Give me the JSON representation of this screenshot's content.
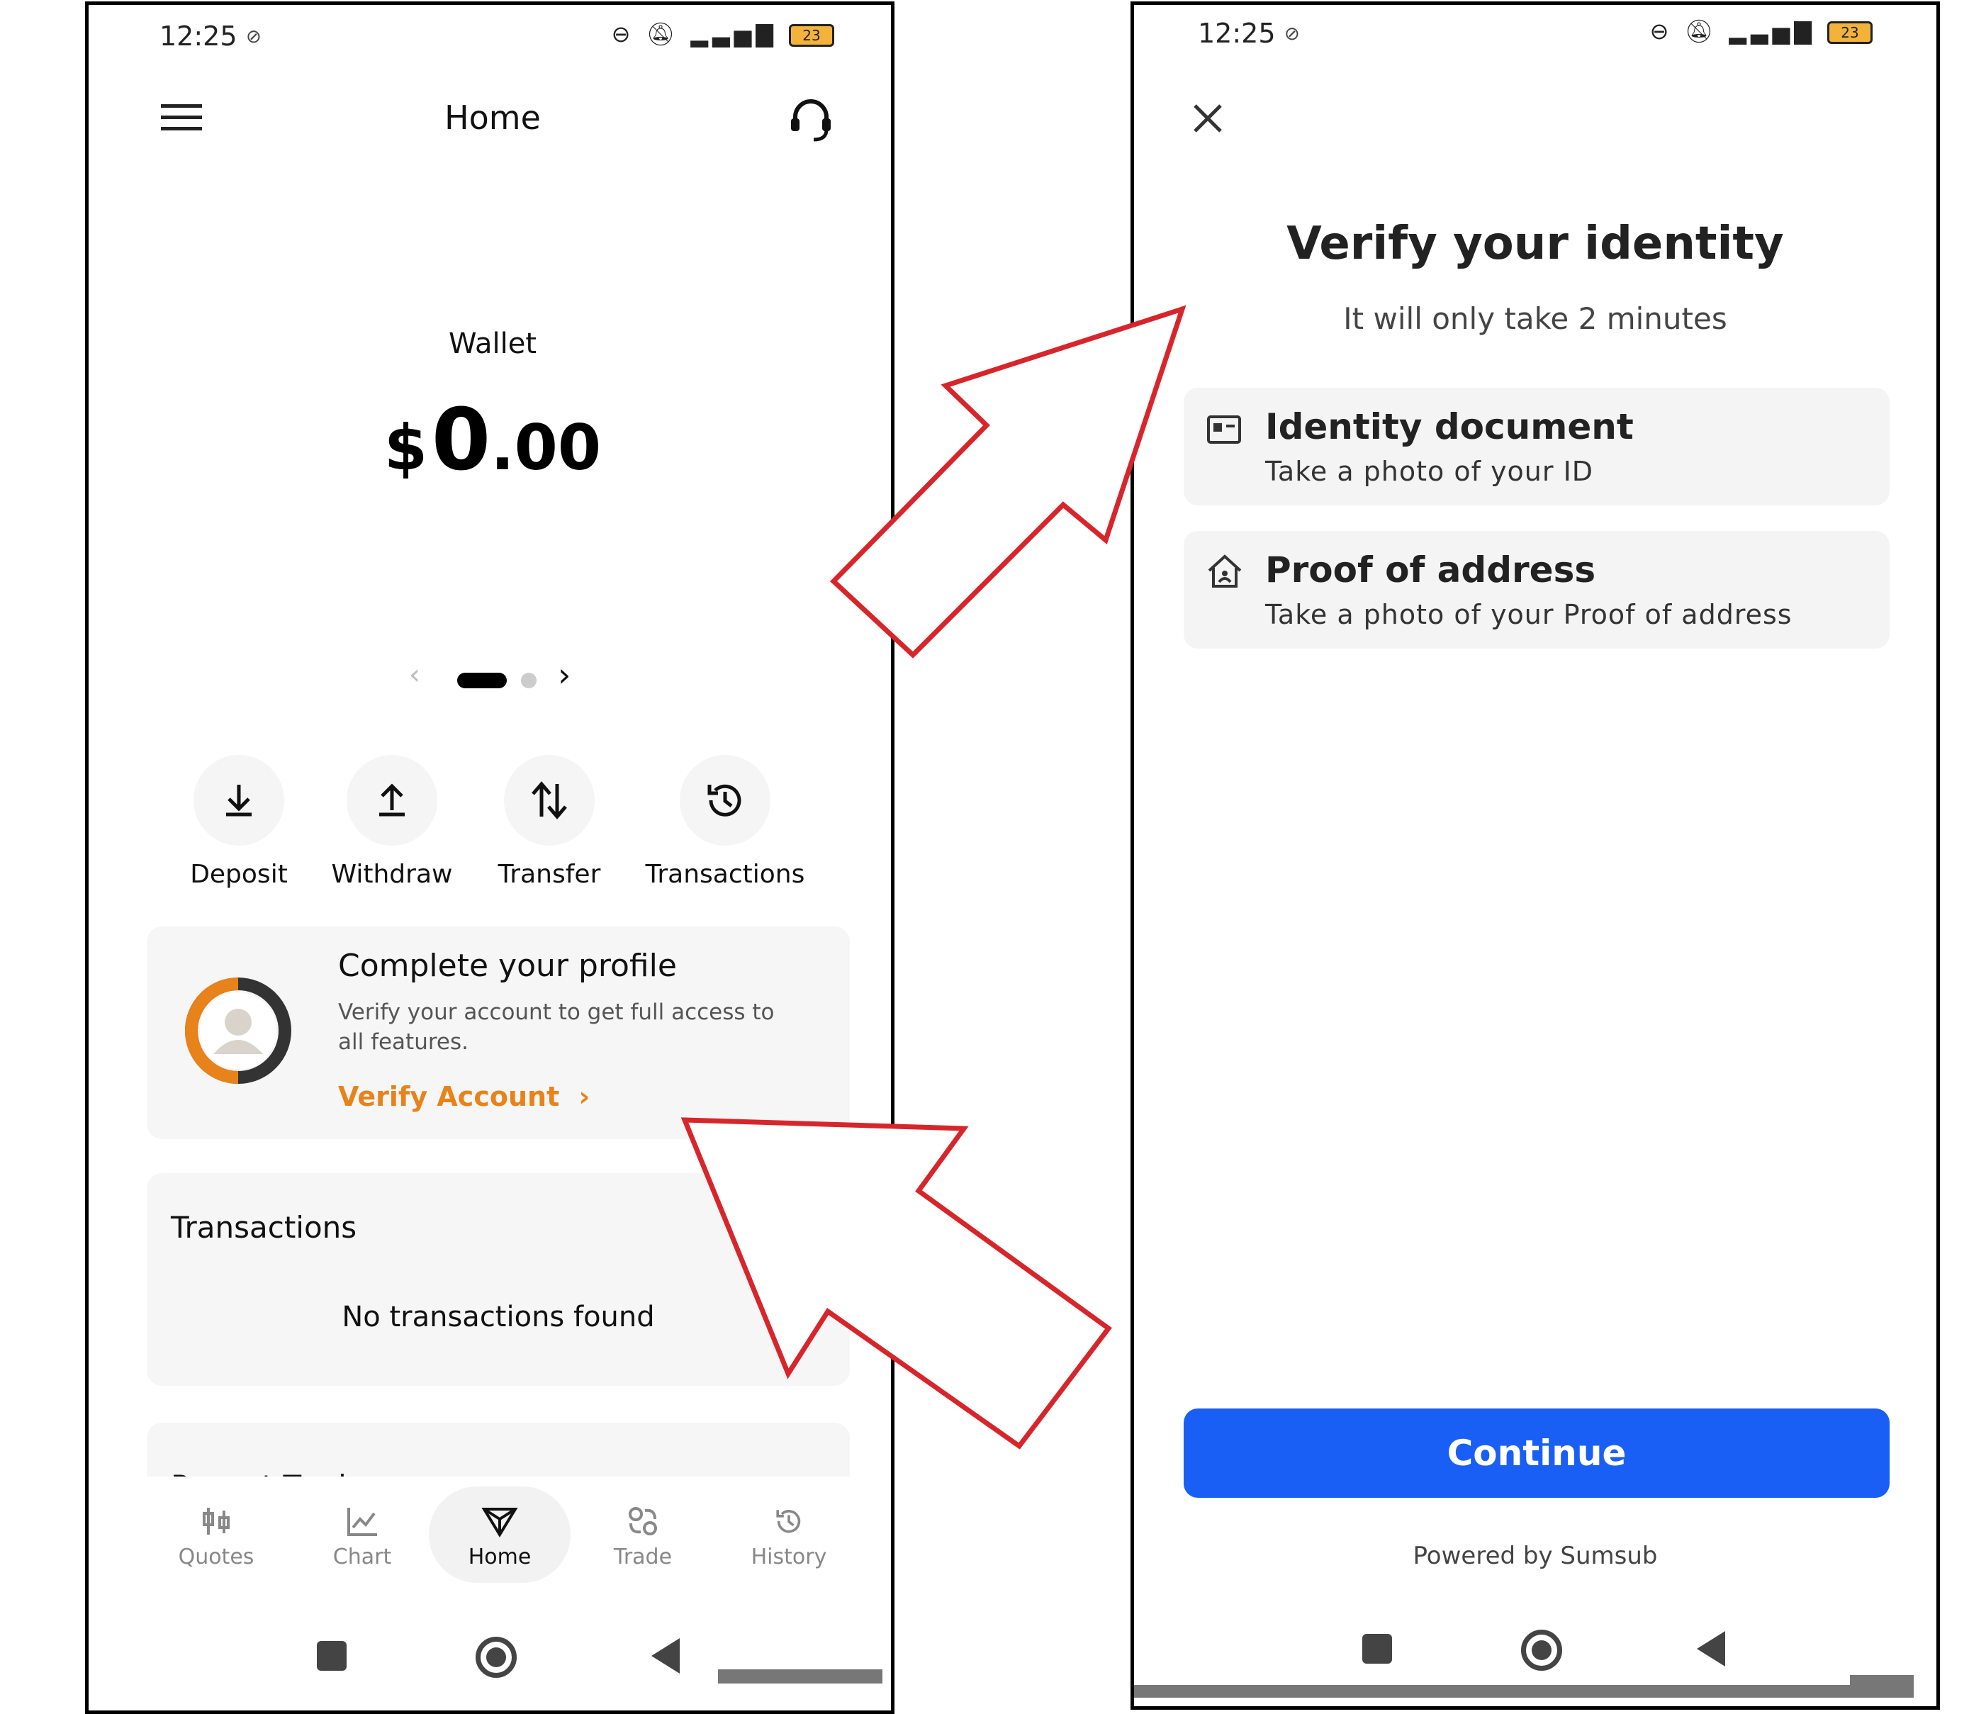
{
  "left_screen": {
    "status": {
      "time": "12:25",
      "battery": "23"
    },
    "header": {
      "title": "Home"
    },
    "wallet": {
      "label": "Wallet",
      "currency": "$",
      "integer": "0",
      "decimals": ".00"
    },
    "actions": [
      {
        "label": "Deposit",
        "icon": "download-icon"
      },
      {
        "label": "Withdraw",
        "icon": "upload-icon"
      },
      {
        "label": "Transfer",
        "icon": "transfer-arrows-icon"
      },
      {
        "label": "Transactions",
        "icon": "history-icon"
      }
    ],
    "profile_card": {
      "title": "Complete your profile",
      "description": "Verify your account to get full access to all features.",
      "link": "Verify Account",
      "link_color": "#e8821a"
    },
    "transactions_card": {
      "title": "Transactions",
      "empty": "No transactions found"
    },
    "recent_trades": {
      "title": "Recent Trades"
    },
    "bottom_nav": [
      {
        "label": "Quotes",
        "icon": "candlestick-icon"
      },
      {
        "label": "Chart",
        "icon": "line-chart-icon"
      },
      {
        "label": "Home",
        "icon": "home-logo-icon",
        "active": true
      },
      {
        "label": "Trade",
        "icon": "trade-icon"
      },
      {
        "label": "History",
        "icon": "history-icon"
      }
    ]
  },
  "right_screen": {
    "status": {
      "time": "12:25",
      "battery": "23"
    },
    "title": "Verify your identity",
    "subtitle": "It will only take 2 minutes",
    "items": [
      {
        "title": "Identity document",
        "subtitle": "Take a photo of your ID",
        "icon": "id-card-icon"
      },
      {
        "title": "Proof of address",
        "subtitle": "Take a photo of your Proof of address",
        "icon": "house-icon"
      }
    ],
    "continue_label": "Continue",
    "continue_color": "#1a5ff5",
    "footer": "Powered by Sumsub"
  },
  "annotation_arrows": {
    "color": "#d7262b"
  }
}
